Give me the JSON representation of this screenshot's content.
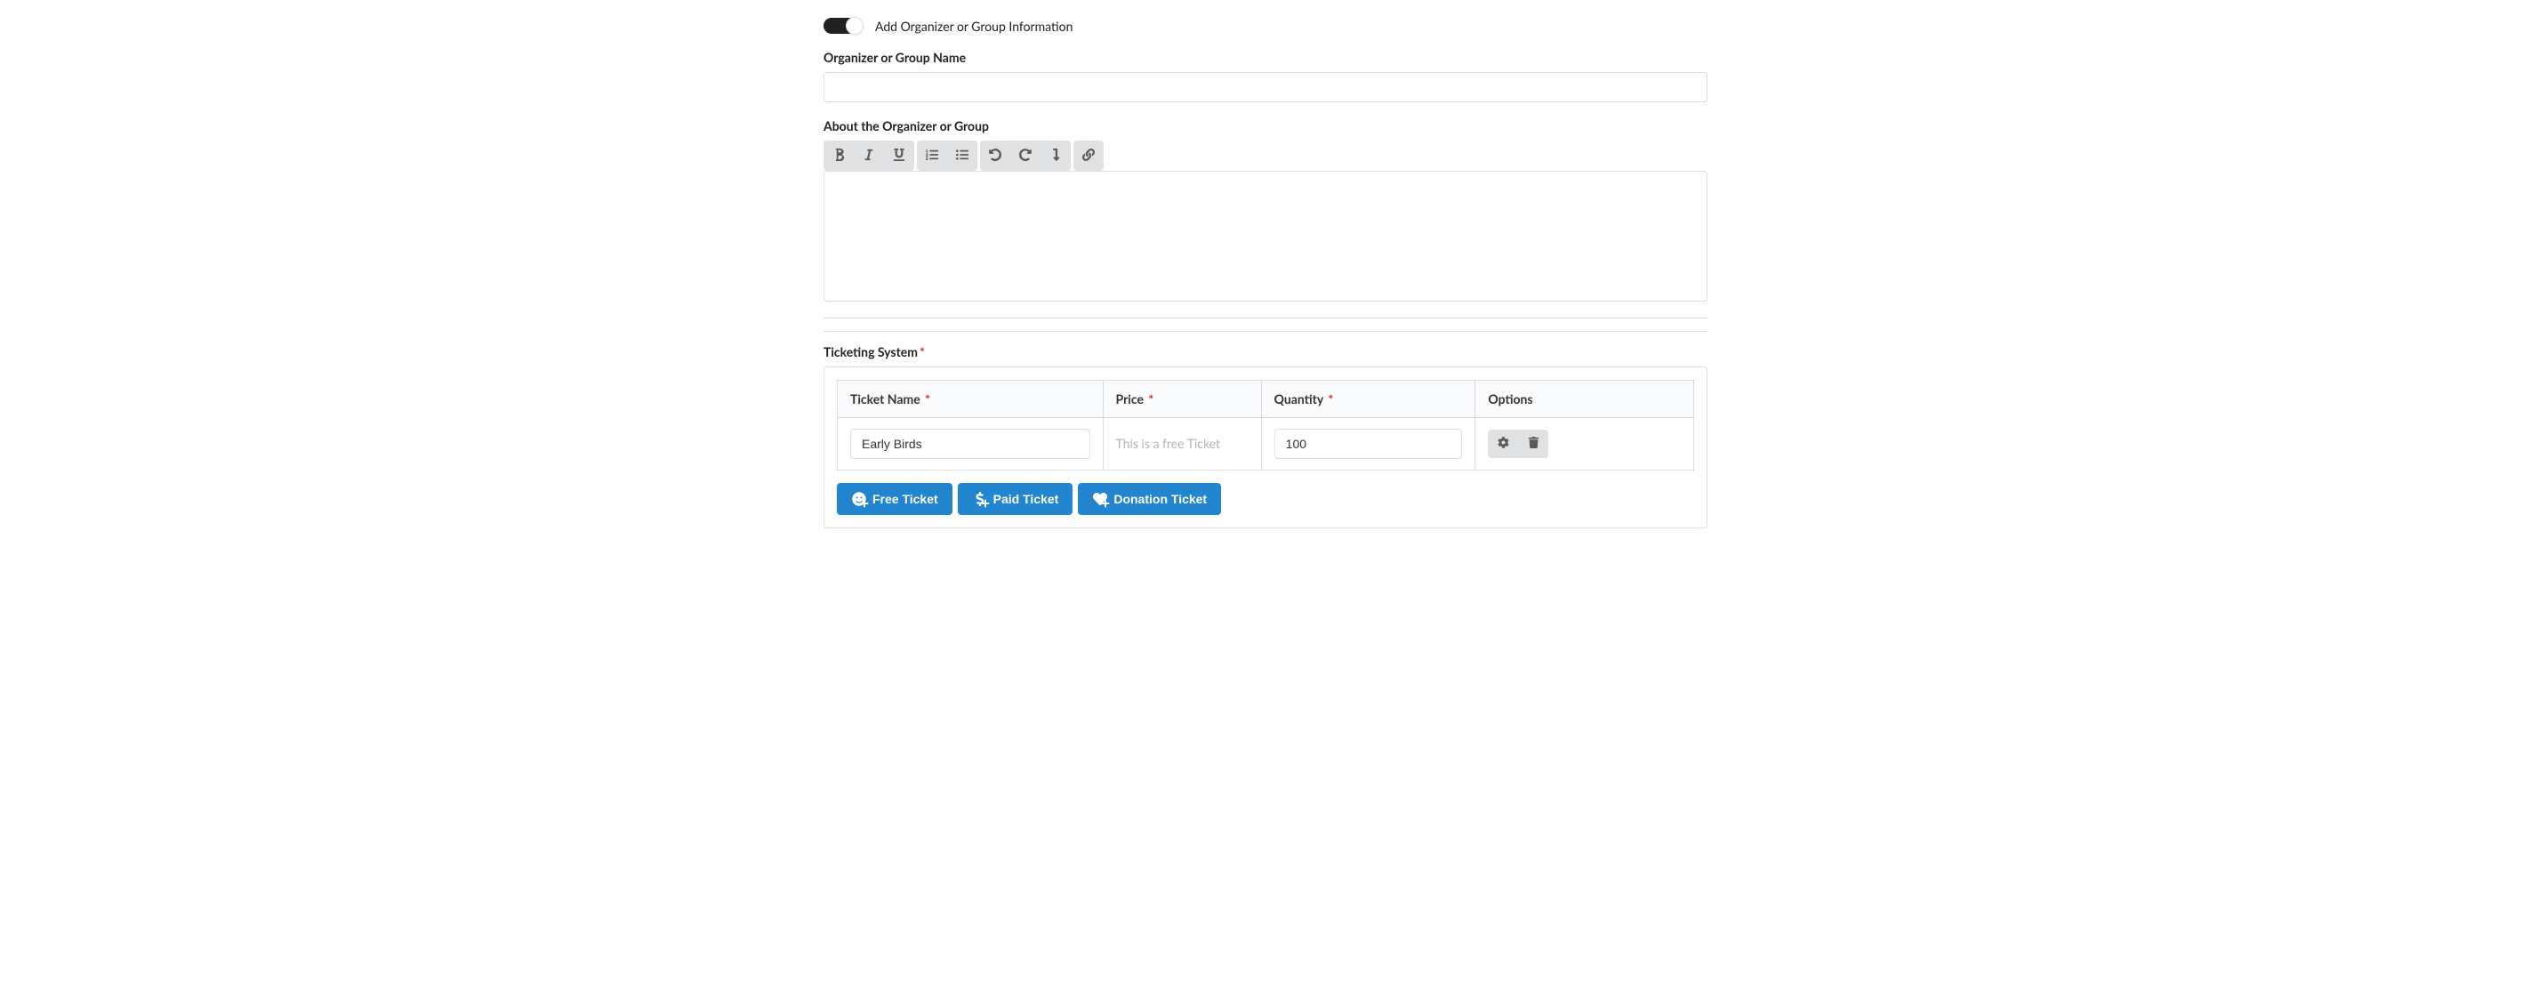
{
  "organizer": {
    "toggle_label": "Add Organizer or Group Information",
    "toggle_on": true,
    "name_label": "Organizer or Group Name",
    "name_value": "",
    "about_label": "About the Organizer or Group",
    "about_value": "",
    "toolbar": {
      "bold": "bold-icon",
      "italic": "italic-icon",
      "underline": "underline-icon",
      "ordered_list": "ordered-list-icon",
      "unordered_list": "unordered-list-icon",
      "undo": "undo-icon",
      "redo": "redo-icon",
      "paragraph": "paragraph-icon",
      "link": "link-icon"
    }
  },
  "ticketing": {
    "section_label": "Ticketing System",
    "section_required": true,
    "columns": {
      "name": "Ticket Name",
      "price": "Price",
      "quantity": "Quantity",
      "options": "Options"
    },
    "columns_required": {
      "name": true,
      "price": true,
      "quantity": true,
      "options": false
    },
    "rows": [
      {
        "name": "Early Birds",
        "price_display": "This is a free Ticket",
        "is_free": true,
        "quantity": "100"
      }
    ],
    "buttons": {
      "free": "Free Ticket",
      "paid": "Paid Ticket",
      "donation": "Donation Ticket"
    },
    "option_icons": {
      "settings": "gear-icon",
      "delete": "trash-icon"
    }
  }
}
